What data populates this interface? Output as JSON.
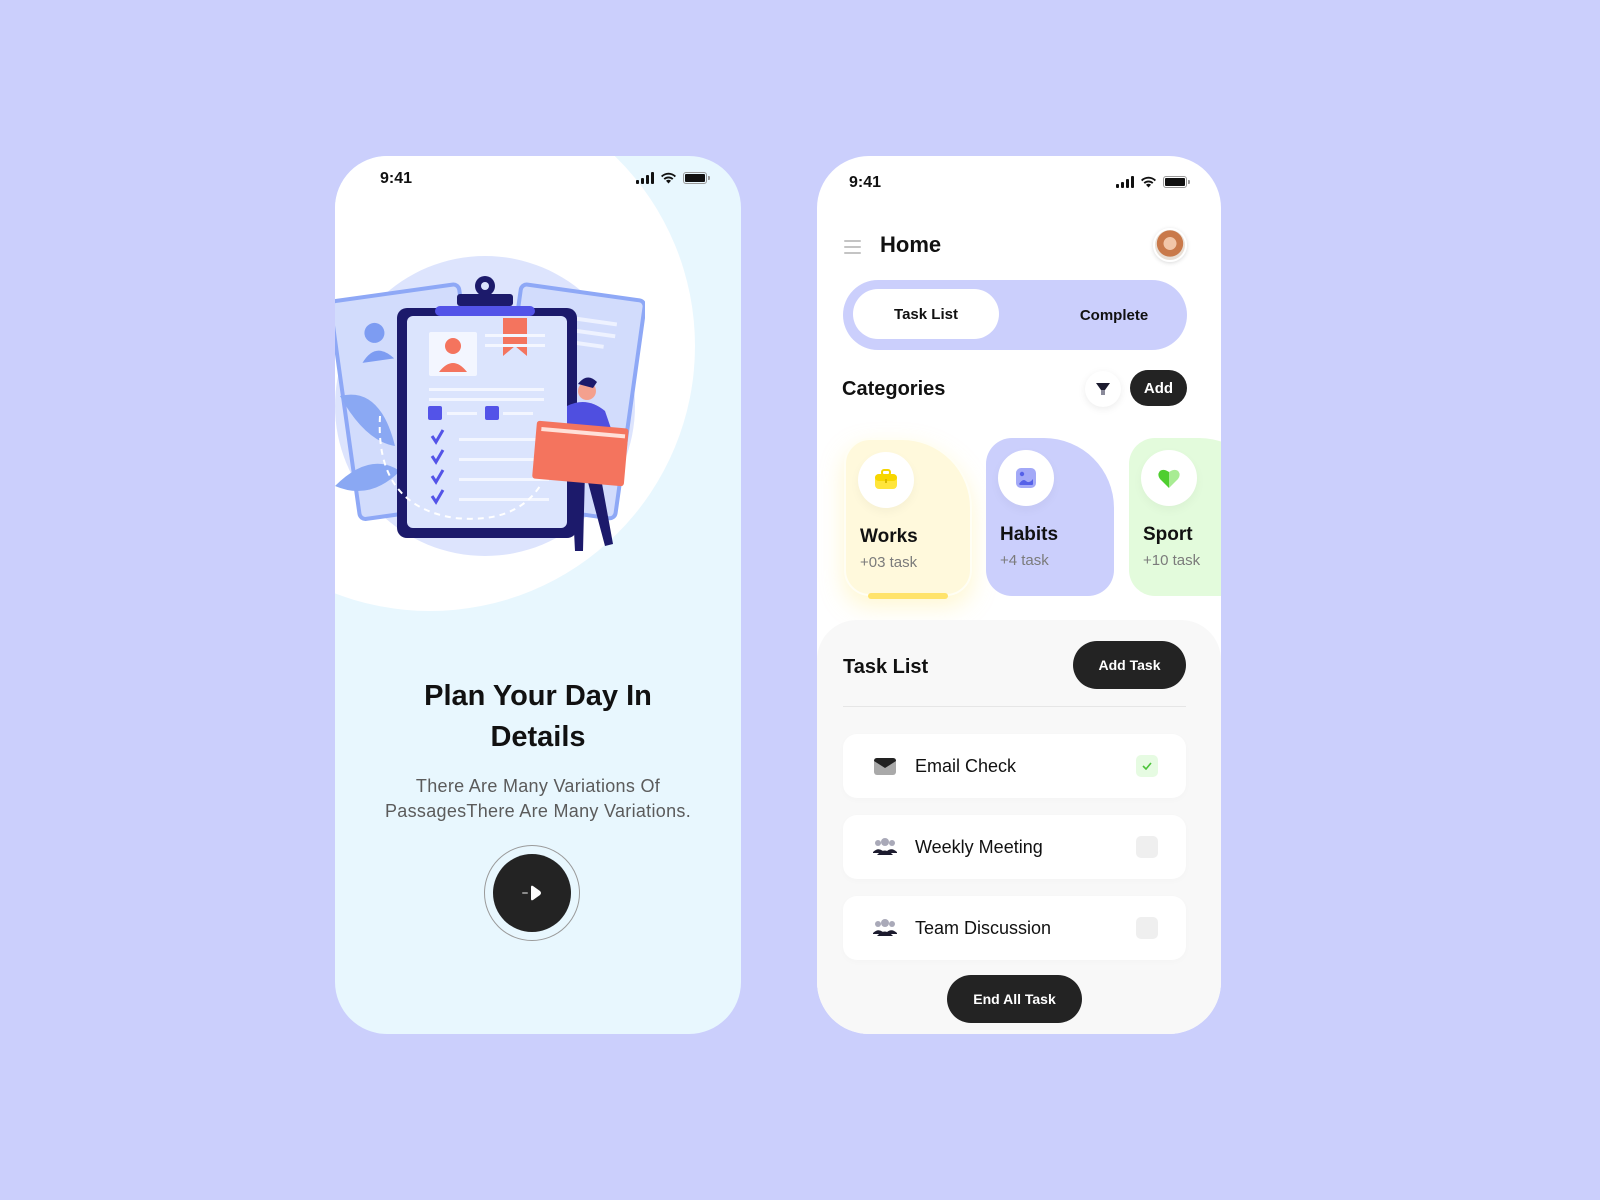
{
  "onboarding": {
    "status_time": "9:41",
    "title": "Plan Your Day In Details",
    "subtitle": "There Are Many Variations Of PassagesThere Are Many Variations.",
    "next_icon": "arrow-right-icon",
    "illustration": "clipboard-checklist-illustration"
  },
  "home": {
    "status_time": "9:41",
    "header": {
      "title": "Home",
      "menu_icon": "hamburger-menu-icon",
      "avatar": "user-avatar"
    },
    "tabs": [
      {
        "label": "Task List",
        "active": true
      },
      {
        "label": "Complete",
        "active": false
      }
    ],
    "categories": {
      "title": "Categories",
      "filter_icon": "filter-funnel-icon",
      "add_label": "Add",
      "items": [
        {
          "name": "Works",
          "count": "+03 task",
          "icon": "briefcase-icon",
          "color": "#fff9dc",
          "selected": true
        },
        {
          "name": "Habits",
          "count": "+4 task",
          "icon": "image-icon",
          "color": "#cbcffc",
          "selected": false
        },
        {
          "name": "Sport",
          "count": "+10 task",
          "icon": "heart-icon",
          "color": "#e3fbdc",
          "selected": false
        }
      ]
    },
    "tasks": {
      "title": "Task List",
      "add_label": "Add Task",
      "items": [
        {
          "label": "Email Check",
          "icon": "envelope-icon",
          "done": true
        },
        {
          "label": "Weekly Meeting",
          "icon": "group-icon",
          "done": false
        },
        {
          "label": "Team Discussion",
          "icon": "group-icon",
          "done": false
        }
      ],
      "end_label": "End All Task"
    }
  },
  "colors": {
    "background": "#cbcffc",
    "accent_dark": "#232323",
    "onboarding_bg": "#e8f7fe",
    "check_green": "#4cc43a"
  }
}
